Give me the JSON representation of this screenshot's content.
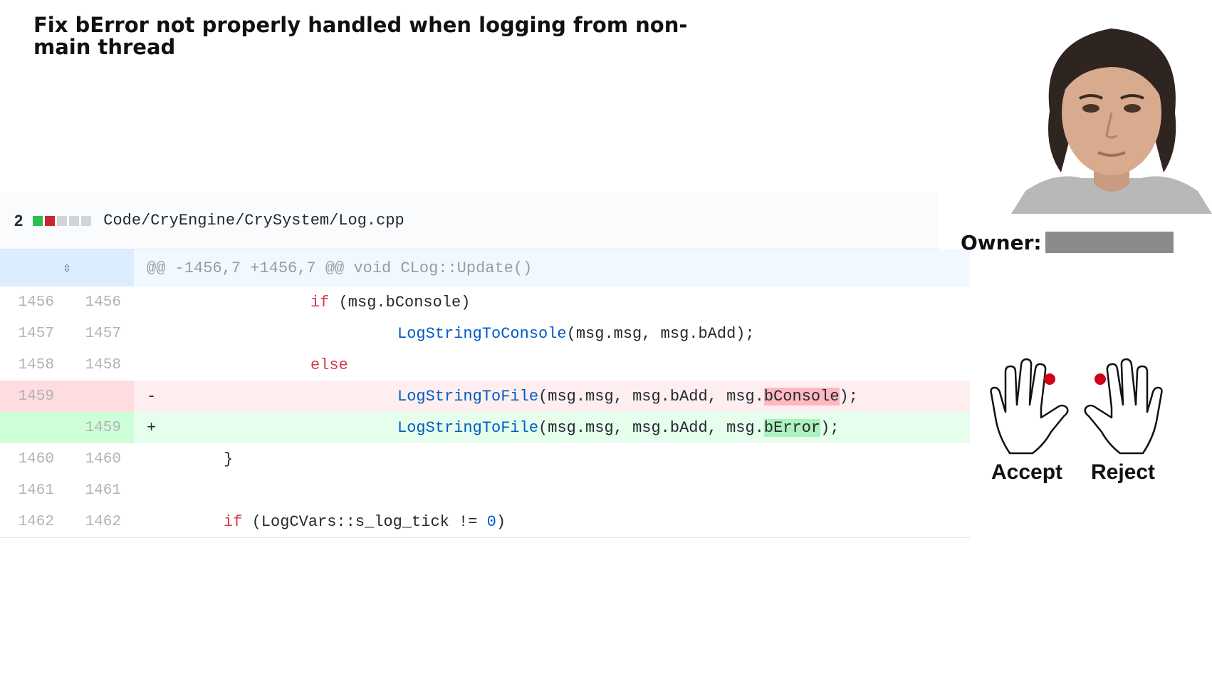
{
  "title": "Fix bError not properly handled when logging from non-main thread",
  "file": {
    "change_count": "2",
    "diffstat": [
      "add",
      "del",
      "neu",
      "neu",
      "neu"
    ],
    "path": "Code/CryEngine/CrySystem/Log.cpp"
  },
  "hunk_header": "@@ -1456,7 +1456,7 @@ void CLog::Update()",
  "lines": [
    {
      "old": "1456",
      "new": "1456",
      "type": "ctx",
      "indent": 2,
      "tokens": [
        {
          "t": "if",
          "c": "kw"
        },
        {
          "t": " (msg.bConsole)",
          "c": ""
        }
      ]
    },
    {
      "old": "1457",
      "new": "1457",
      "type": "ctx",
      "indent": 3,
      "tokens": [
        {
          "t": "LogStringToConsole",
          "c": "fn"
        },
        {
          "t": "(msg.msg, msg.bAdd);",
          "c": ""
        }
      ]
    },
    {
      "old": "1458",
      "new": "1458",
      "type": "ctx",
      "indent": 2,
      "tokens": [
        {
          "t": "else",
          "c": "kw"
        }
      ]
    },
    {
      "old": "1459",
      "new": "",
      "type": "del",
      "marker": "-",
      "indent": 3,
      "tokens": [
        {
          "t": "LogStringToFile",
          "c": "fn"
        },
        {
          "t": "(msg.msg, msg.bAdd, msg.",
          "c": ""
        },
        {
          "t": "bConsole",
          "c": "hl-del"
        },
        {
          "t": ");",
          "c": ""
        }
      ]
    },
    {
      "old": "",
      "new": "1459",
      "type": "add",
      "marker": "+",
      "indent": 3,
      "tokens": [
        {
          "t": "LogStringToFile",
          "c": "fn"
        },
        {
          "t": "(msg.msg, msg.bAdd, msg.",
          "c": ""
        },
        {
          "t": "bError",
          "c": "hl-add"
        },
        {
          "t": ");",
          "c": ""
        }
      ]
    },
    {
      "old": "1460",
      "new": "1460",
      "type": "ctx",
      "indent": 1,
      "tokens": [
        {
          "t": "}",
          "c": ""
        }
      ]
    },
    {
      "old": "1461",
      "new": "1461",
      "type": "ctx",
      "indent": 0,
      "tokens": []
    },
    {
      "old": "1462",
      "new": "1462",
      "type": "ctx",
      "indent": 1,
      "tokens": [
        {
          "t": "if",
          "c": "kw"
        },
        {
          "t": " (LogCVars::s_log_tick != ",
          "c": ""
        },
        {
          "t": "0",
          "c": "nm"
        },
        {
          "t": ")",
          "c": ""
        }
      ]
    }
  ],
  "owner_label": "Owner:",
  "accept_label": "Accept",
  "reject_label": "Reject",
  "colors": {
    "add": "#2cbe4e",
    "del": "#cb2431",
    "keyword": "#d73a49",
    "function": "#005cc5",
    "marker_dot": "#d0021b"
  }
}
